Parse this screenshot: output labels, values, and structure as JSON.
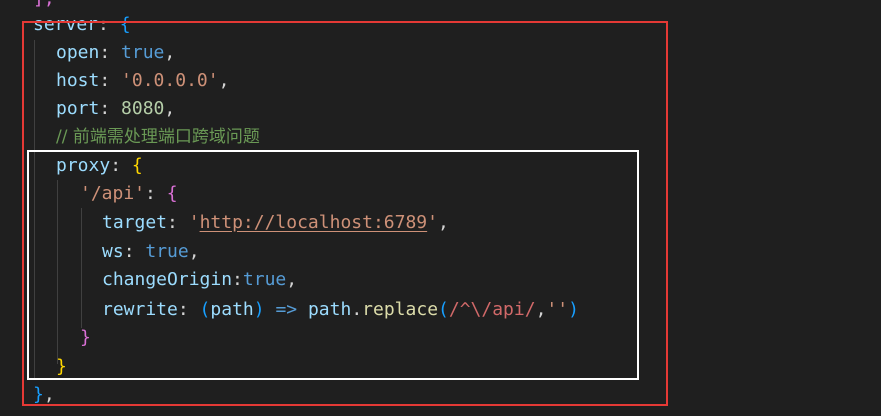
{
  "code": {
    "top_fragment": "],",
    "server_key": "server",
    "server_brace": "{",
    "open_key": "open",
    "open_value": "true",
    "host_key": "host",
    "host_value": "'0.0.0.0'",
    "port_key": "port",
    "port_value": "8080",
    "comment": "// 前端需处理端口跨域问题",
    "proxy_key": "proxy",
    "proxy_brace": "{",
    "api_key": "'/api'",
    "api_brace": "{",
    "target_key": "target",
    "target_quote_open": "'",
    "target_url": "http://localhost:6789",
    "target_quote_close": "'",
    "ws_key": "ws",
    "ws_value": "true",
    "change_origin_key": "changeOrigin",
    "change_origin_value": "true",
    "rewrite_key": "rewrite",
    "rewrite_param": "path",
    "rewrite_arrow": "=>",
    "rewrite_obj": "path",
    "rewrite_method": "replace",
    "rewrite_regex": "/^\\/api/",
    "rewrite_replacement": "''",
    "api_close": "}",
    "proxy_close": "}",
    "server_close": "}",
    "server_close_comma": ","
  },
  "highlight_colors": {
    "outer_box": "#e53935",
    "inner_box": "#ffffff"
  }
}
